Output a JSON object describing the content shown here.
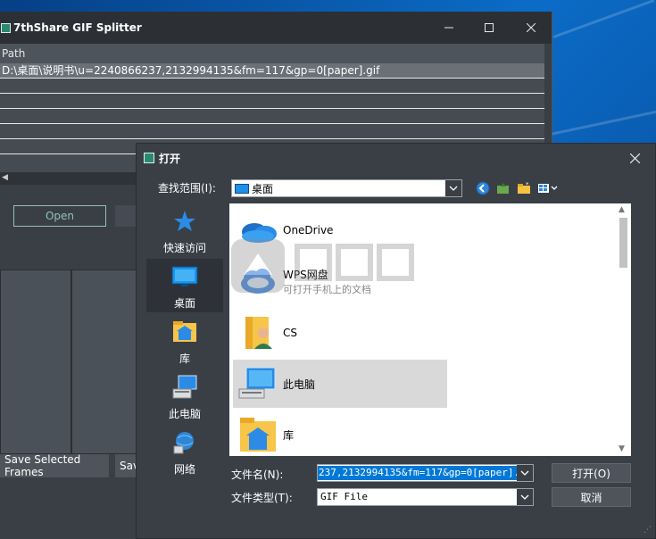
{
  "main_window": {
    "title": "7thShare GIF Splitter",
    "list_header": "Path",
    "rows": [
      "D:\\桌面\\说明书\\u=2240866237,2132994135&fm=117&gp=0[paper].gif",
      "",
      "",
      "",
      "",
      "",
      ""
    ],
    "open_label": "Open",
    "save_selected_label": "Save Selected Frames",
    "save_partial_label": "Sav"
  },
  "dialog": {
    "title": "打开",
    "look_in_label": "查找范围(I):",
    "look_in_value": "桌面",
    "places": [
      {
        "label": "快速访问",
        "icon": "star-icon"
      },
      {
        "label": "桌面",
        "icon": "desktop-icon"
      },
      {
        "label": "库",
        "icon": "library-icon"
      },
      {
        "label": "此电脑",
        "icon": "computer-icon"
      },
      {
        "label": "网络",
        "icon": "network-icon"
      }
    ],
    "files": [
      {
        "name": "OneDrive",
        "sub": "",
        "icon": "onedrive-icon"
      },
      {
        "name": "WPS网盘",
        "sub": "可打开手机上的文档",
        "icon": "wps-cloud-icon"
      },
      {
        "name": "CS",
        "sub": "",
        "icon": "user-folder-icon"
      },
      {
        "name": "此电脑",
        "sub": "",
        "icon": "computer-icon"
      },
      {
        "name": "库",
        "sub": "",
        "icon": "library-icon"
      }
    ],
    "filename_label": "文件名(N):",
    "filename_value": "237,2132994135&fm=117&gp=0[paper].gif",
    "filetype_label": "文件类型(T):",
    "filetype_value": "GIF File",
    "open_button": "打开(O)",
    "cancel_button": "取消"
  },
  "colors": {
    "accent": "#8fc4b0",
    "selection": "#0078d7",
    "dialog_bg": "#3a3f46"
  }
}
